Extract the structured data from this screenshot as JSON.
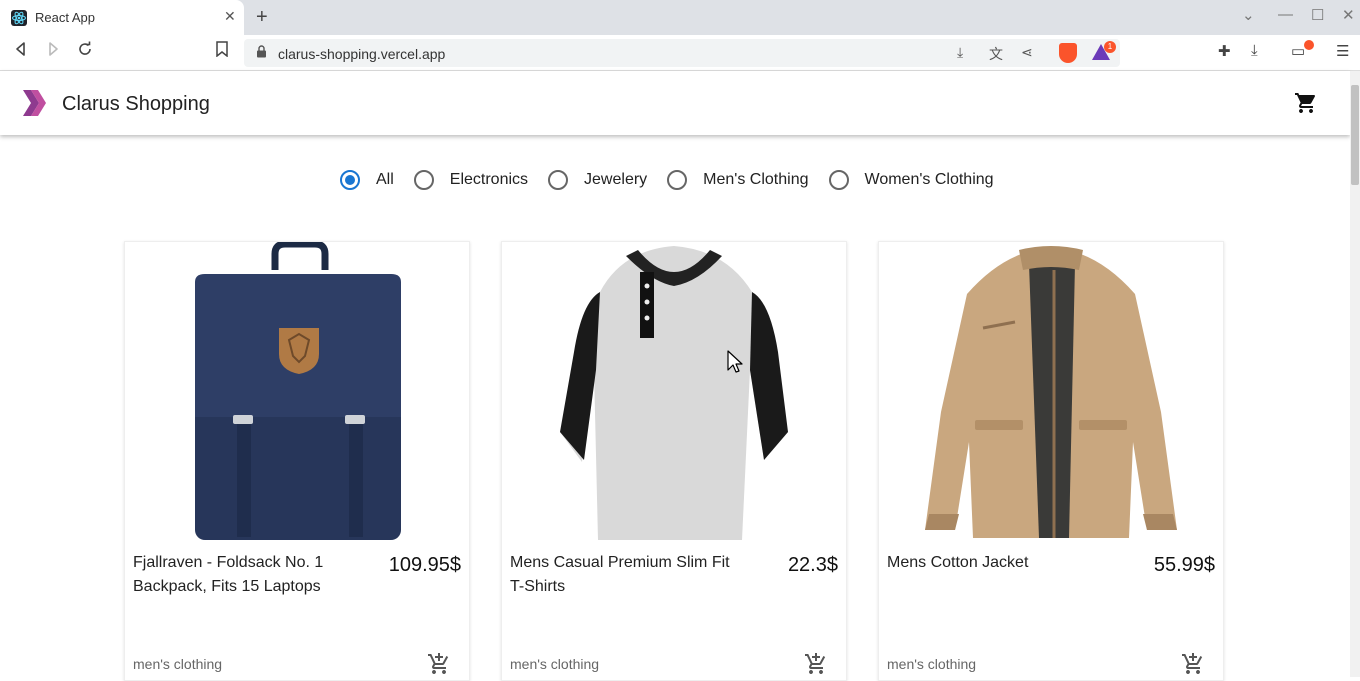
{
  "browser": {
    "tab_title": "React App",
    "url": "clarus-shopping.vercel.app",
    "rewards_badge": "1"
  },
  "app": {
    "title": "Clarus Shopping",
    "accent": "#1976d2"
  },
  "filters": [
    {
      "label": "All",
      "checked": true
    },
    {
      "label": "Electronics",
      "checked": false
    },
    {
      "label": "Jewelery",
      "checked": false
    },
    {
      "label": "Men's Clothing",
      "checked": false
    },
    {
      "label": "Women's Clothing",
      "checked": false
    }
  ],
  "products": [
    {
      "title": "Fjallraven - Foldsack No. 1 Backpack, Fits 15 Laptops",
      "price": "109.95$",
      "category": "men's clothing",
      "image_icon": "backpack-image"
    },
    {
      "title": "Mens Casual Premium Slim Fit T-Shirts",
      "price": "22.3$",
      "category": "men's clothing",
      "image_icon": "tshirt-image"
    },
    {
      "title": "Mens Cotton Jacket",
      "price": "55.99$",
      "category": "men's clothing",
      "image_icon": "jacket-image"
    }
  ]
}
